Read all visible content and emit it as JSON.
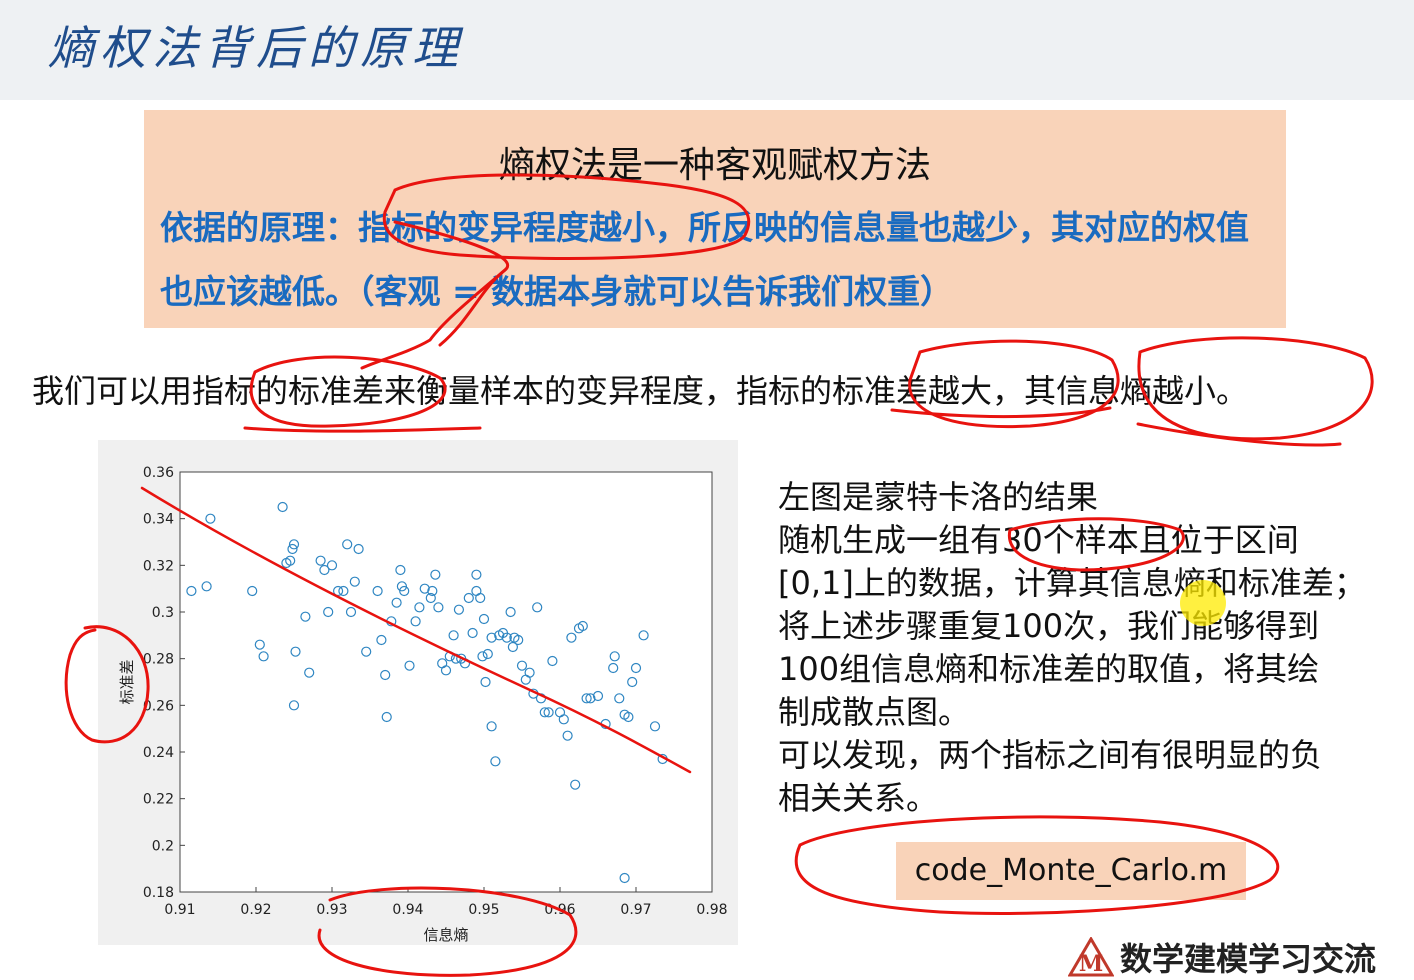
{
  "slide": {
    "title": "熵权法背后的原理"
  },
  "principle_box": {
    "heading": "熵权法是一种客观赋权方法",
    "text": "依据的原理：指标的变异程度越小，所反映的信息量也越少，其对应的权值也应该越低。（客观 = 数据本身就可以告诉我们权重）"
  },
  "sentence": "我们可以用指标的标准差来衡量样本的变异程度，指标的标准差越大，其信息熵越小。",
  "right_text": {
    "lines": [
      "左图是蒙特卡洛的结果",
      "随机生成一组有30个样本且位于区间",
      "[0,1]上的数据，计算其信息熵和标准差；",
      "将上述步骤重复100次，我们能够得到",
      "100组信息熵和标准差的取值，将其绘",
      "制成散点图。",
      "可以发现，两个指标之间有很明显的负",
      "相关关系。"
    ]
  },
  "code_file": "code_Monte_Carlo.m",
  "watermark": {
    "logo_letter": "M",
    "text": "数学建模学习交流"
  },
  "colors": {
    "title": "#1f4d8c",
    "box_text": "#1a6bc0",
    "box_bg": "#f9d3b9",
    "marker": "#2f86c2",
    "annotation": "#e8130f"
  },
  "chart_data": {
    "type": "scatter",
    "xlabel": "信息熵",
    "ylabel": "标准差",
    "xlim": [
      0.91,
      0.98
    ],
    "ylim": [
      0.18,
      0.36
    ],
    "x_ticks": [
      "0.91",
      "0.92",
      "0.93",
      "0.94",
      "0.95",
      "0.96",
      "0.97",
      "0.98"
    ],
    "y_ticks": [
      "0.18",
      "0.2",
      "0.22",
      "0.24",
      "0.26",
      "0.28",
      "0.3",
      "0.32",
      "0.34",
      "0.36"
    ],
    "marker": "circle-open",
    "points": [
      [
        0.9115,
        0.309
      ],
      [
        0.9135,
        0.311
      ],
      [
        0.914,
        0.34
      ],
      [
        0.9195,
        0.309
      ],
      [
        0.9205,
        0.286
      ],
      [
        0.921,
        0.281
      ],
      [
        0.9235,
        0.345
      ],
      [
        0.924,
        0.321
      ],
      [
        0.9245,
        0.322
      ],
      [
        0.9248,
        0.327
      ],
      [
        0.925,
        0.329
      ],
      [
        0.925,
        0.26
      ],
      [
        0.9252,
        0.283
      ],
      [
        0.9265,
        0.298
      ],
      [
        0.927,
        0.274
      ],
      [
        0.9285,
        0.322
      ],
      [
        0.929,
        0.318
      ],
      [
        0.9295,
        0.3
      ],
      [
        0.93,
        0.32
      ],
      [
        0.9308,
        0.309
      ],
      [
        0.9315,
        0.309
      ],
      [
        0.932,
        0.329
      ],
      [
        0.9325,
        0.3
      ],
      [
        0.933,
        0.313
      ],
      [
        0.9335,
        0.327
      ],
      [
        0.9345,
        0.283
      ],
      [
        0.936,
        0.309
      ],
      [
        0.9365,
        0.288
      ],
      [
        0.937,
        0.273
      ],
      [
        0.9372,
        0.255
      ],
      [
        0.9378,
        0.296
      ],
      [
        0.9385,
        0.304
      ],
      [
        0.939,
        0.318
      ],
      [
        0.9392,
        0.311
      ],
      [
        0.9395,
        0.309
      ],
      [
        0.9402,
        0.277
      ],
      [
        0.941,
        0.296
      ],
      [
        0.9415,
        0.302
      ],
      [
        0.9422,
        0.31
      ],
      [
        0.943,
        0.306
      ],
      [
        0.9432,
        0.309
      ],
      [
        0.9436,
        0.316
      ],
      [
        0.944,
        0.302
      ],
      [
        0.9445,
        0.278
      ],
      [
        0.945,
        0.275
      ],
      [
        0.9455,
        0.281
      ],
      [
        0.946,
        0.29
      ],
      [
        0.9463,
        0.28
      ],
      [
        0.9467,
        0.301
      ],
      [
        0.947,
        0.28
      ],
      [
        0.9475,
        0.278
      ],
      [
        0.948,
        0.306
      ],
      [
        0.9485,
        0.291
      ],
      [
        0.949,
        0.316
      ],
      [
        0.949,
        0.309
      ],
      [
        0.9495,
        0.306
      ],
      [
        0.9498,
        0.281
      ],
      [
        0.95,
        0.297
      ],
      [
        0.9502,
        0.27
      ],
      [
        0.9505,
        0.282
      ],
      [
        0.951,
        0.251
      ],
      [
        0.951,
        0.289
      ],
      [
        0.9515,
        0.236
      ],
      [
        0.952,
        0.29
      ],
      [
        0.9525,
        0.291
      ],
      [
        0.953,
        0.289
      ],
      [
        0.9535,
        0.3
      ],
      [
        0.9538,
        0.285
      ],
      [
        0.954,
        0.289
      ],
      [
        0.9545,
        0.288
      ],
      [
        0.955,
        0.277
      ],
      [
        0.9555,
        0.271
      ],
      [
        0.956,
        0.274
      ],
      [
        0.9565,
        0.265
      ],
      [
        0.957,
        0.302
      ],
      [
        0.9575,
        0.263
      ],
      [
        0.958,
        0.257
      ],
      [
        0.9585,
        0.257
      ],
      [
        0.959,
        0.279
      ],
      [
        0.96,
        0.257
      ],
      [
        0.9605,
        0.254
      ],
      [
        0.961,
        0.247
      ],
      [
        0.9615,
        0.289
      ],
      [
        0.9625,
        0.293
      ],
      [
        0.963,
        0.294
      ],
      [
        0.9635,
        0.263
      ],
      [
        0.964,
        0.263
      ],
      [
        0.965,
        0.264
      ],
      [
        0.966,
        0.252
      ],
      [
        0.967,
        0.276
      ],
      [
        0.9672,
        0.281
      ],
      [
        0.9678,
        0.263
      ],
      [
        0.9685,
        0.256
      ],
      [
        0.969,
        0.255
      ],
      [
        0.9695,
        0.27
      ],
      [
        0.97,
        0.276
      ],
      [
        0.971,
        0.29
      ],
      [
        0.9725,
        0.251
      ],
      [
        0.9735,
        0.237
      ],
      [
        0.962,
        0.226
      ],
      [
        0.9685,
        0.186
      ]
    ]
  }
}
